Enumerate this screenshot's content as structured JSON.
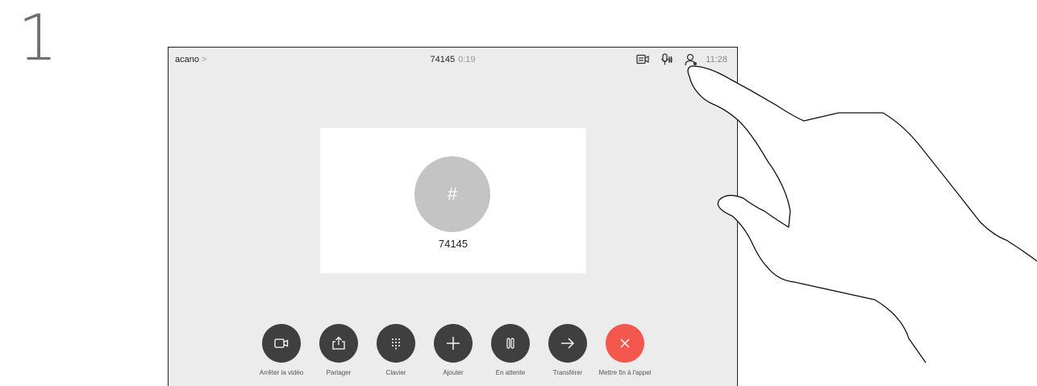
{
  "step": {
    "number": "1"
  },
  "topbar": {
    "contact": "acano",
    "chevron": ">",
    "call_number": "74145",
    "call_duration": "0:19",
    "time": "11:28",
    "icons": [
      "self-view-icon",
      "mute-mic-icon",
      "participants-icon"
    ]
  },
  "card": {
    "avatar_symbol": "#",
    "number": "74145"
  },
  "controls": [
    {
      "label": "Arrêter la vidéo",
      "icon": "camera-icon"
    },
    {
      "label": "Partager",
      "icon": "share-icon"
    },
    {
      "label": "Clavier",
      "icon": "keypad-icon"
    },
    {
      "label": "Ajouter",
      "icon": "plus-icon"
    },
    {
      "label": "En attente",
      "icon": "pause-icon"
    },
    {
      "label": "Transférer",
      "icon": "arrow-right-icon"
    },
    {
      "label": "Mettre fin à l'appel",
      "icon": "close-icon"
    }
  ],
  "colors": {
    "end_call": "#f4574c",
    "control_button": "#3f3f3f",
    "screen_background": "#ececec",
    "avatar": "#c4c4c4"
  }
}
